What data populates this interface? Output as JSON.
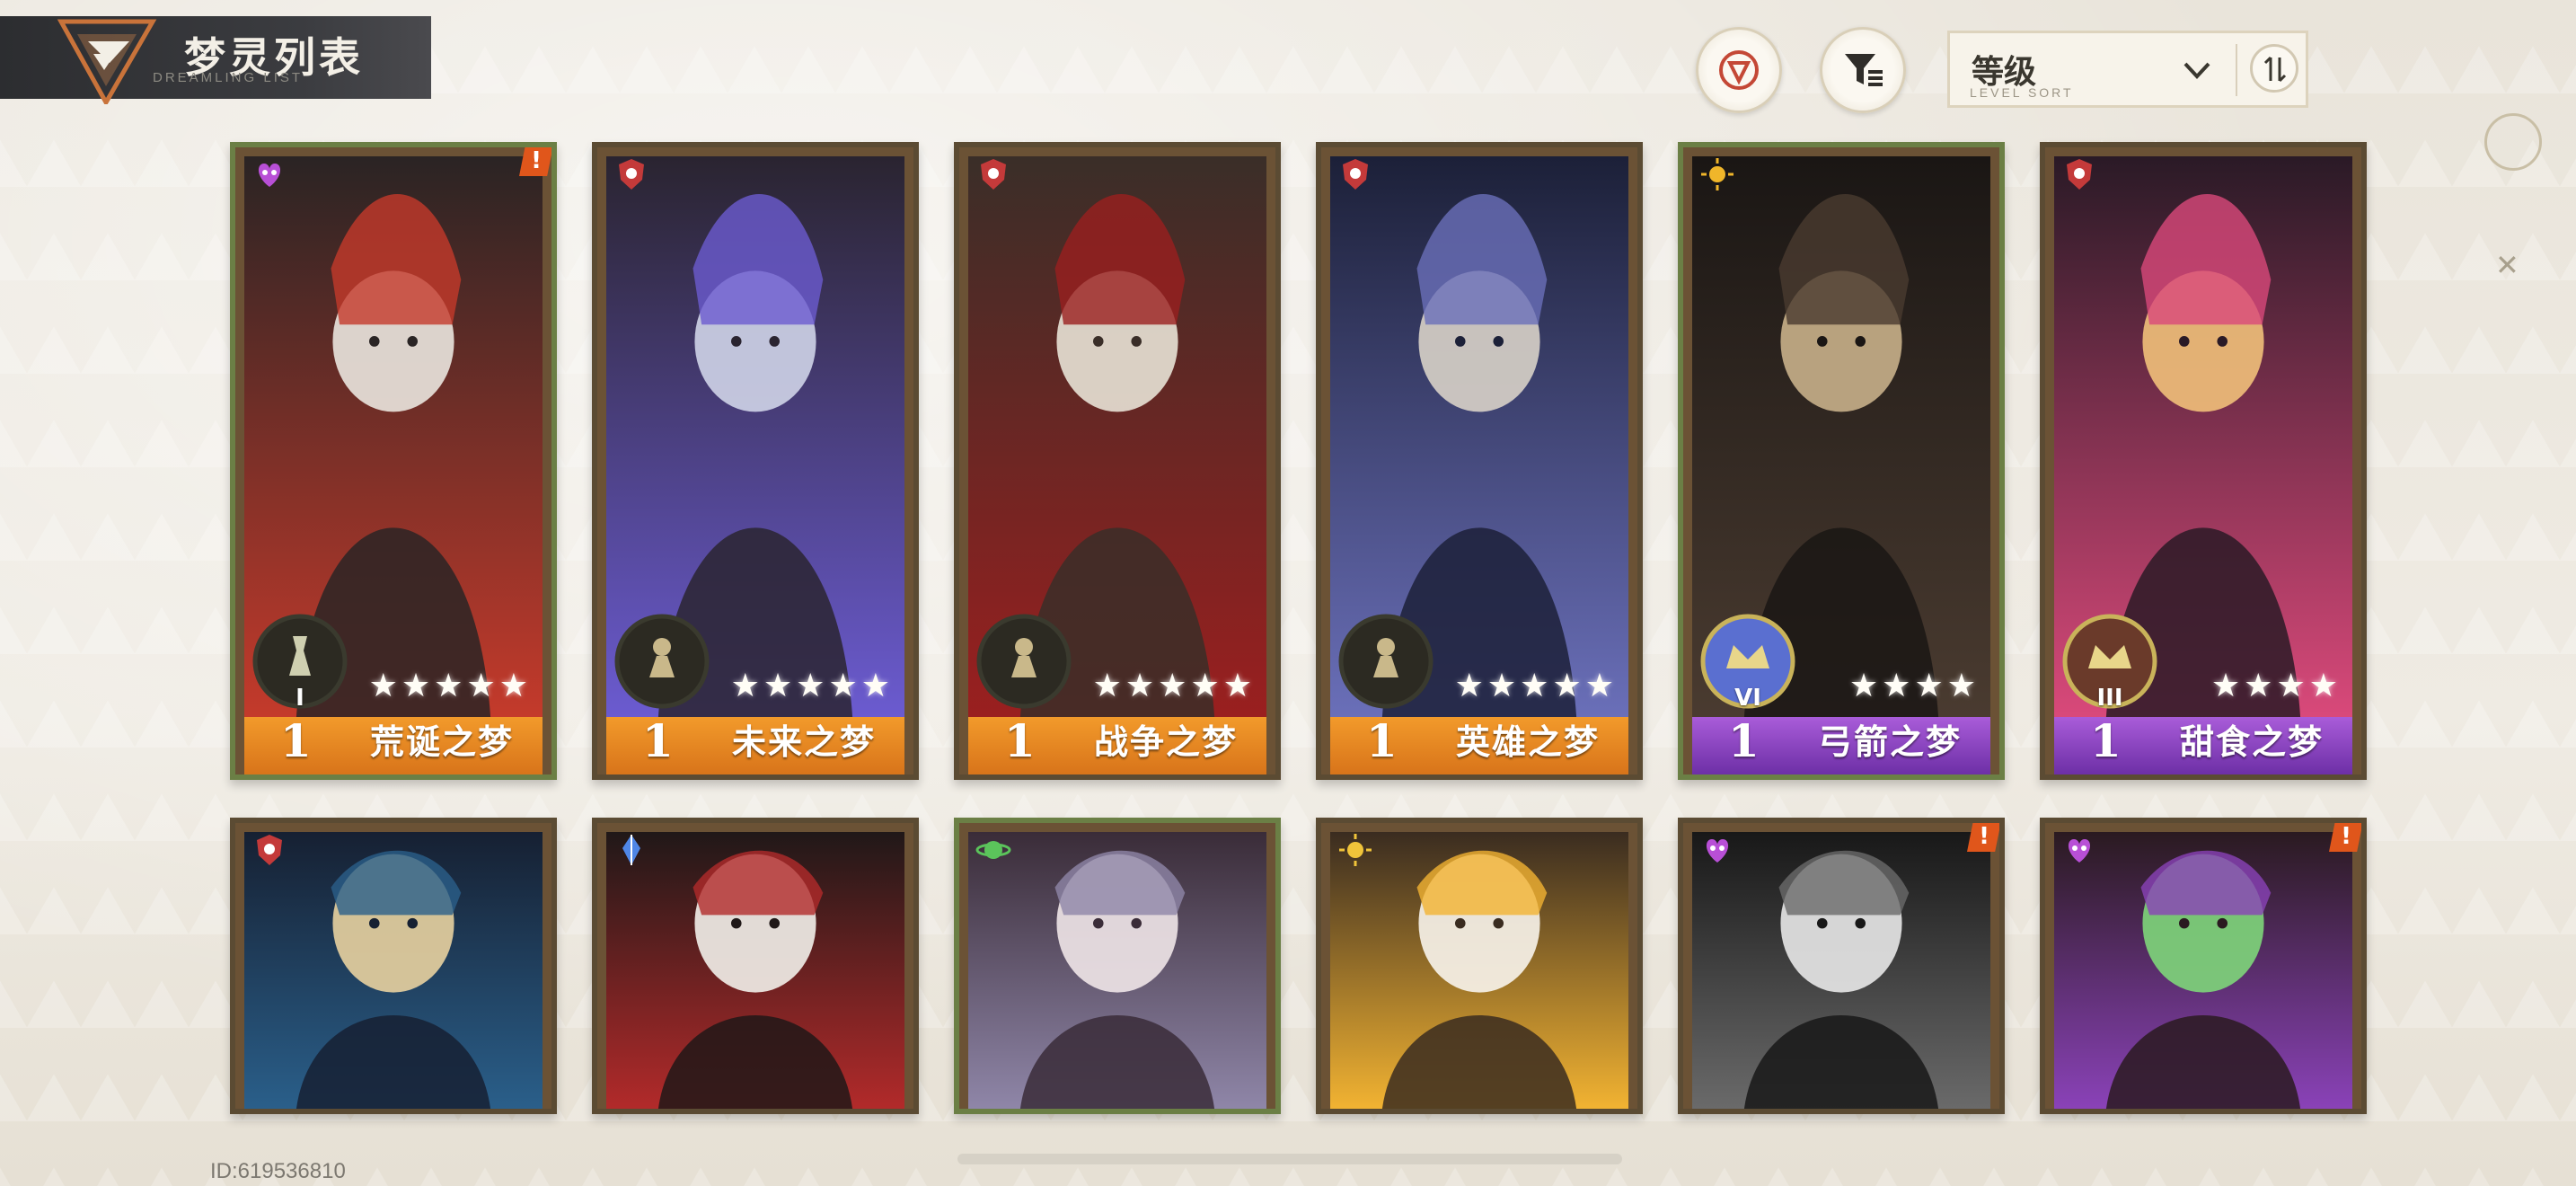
{
  "header": {
    "title": "梦灵列表",
    "subtitle": "DREAMLING LIST"
  },
  "toolbar": {
    "filter_icon_a": "faction-filter-icon",
    "filter_icon_b": "funnel-filter-icon",
    "sort_label": "等级",
    "sort_sub": "LEVEL SORT",
    "order_icon": "sort-order-icon"
  },
  "accent_colors": {
    "orange_rarity": "#f29a2b",
    "purple_rarity": "#8d41c3",
    "card_frame": "#5b4b33",
    "selected_frame": "#6b7f45"
  },
  "cards_row1": [
    {
      "level": "1",
      "name": "荒诞之梦",
      "stars": "★★★★★",
      "rarity": "orange",
      "rank": "I",
      "class_icon": "heart-mask-icon",
      "alert": "!"
    },
    {
      "level": "1",
      "name": "未来之梦",
      "stars": "★★★★★",
      "rarity": "orange",
      "rank": "",
      "class_icon": "shield-icon",
      "alert": ""
    },
    {
      "level": "1",
      "name": "战争之梦",
      "stars": "★★★★★",
      "rarity": "orange",
      "rank": "",
      "class_icon": "shield-icon",
      "alert": ""
    },
    {
      "level": "1",
      "name": "英雄之梦",
      "stars": "★★★★★",
      "rarity": "orange",
      "rank": "",
      "class_icon": "shield-icon",
      "alert": ""
    },
    {
      "level": "1",
      "name": "弓箭之梦",
      "stars": "★★★★",
      "rarity": "purple",
      "rank": "VI",
      "class_icon": "sun-orb-icon",
      "alert": ""
    },
    {
      "level": "1",
      "name": "甜食之梦",
      "stars": "★★★★",
      "rarity": "purple",
      "rank": "III",
      "class_icon": "shield-icon",
      "alert": ""
    }
  ],
  "cards_row2": [
    {
      "class_icon": "shield-icon",
      "alert": ""
    },
    {
      "class_icon": "crystal-icon",
      "alert": ""
    },
    {
      "class_icon": "planet-icon",
      "alert": ""
    },
    {
      "class_icon": "sun-icon",
      "alert": ""
    },
    {
      "class_icon": "heart-mask-icon",
      "alert": "!"
    },
    {
      "class_icon": "heart-mask-icon",
      "alert": "!"
    }
  ],
  "footer": {
    "user_id": "ID:619536810"
  }
}
